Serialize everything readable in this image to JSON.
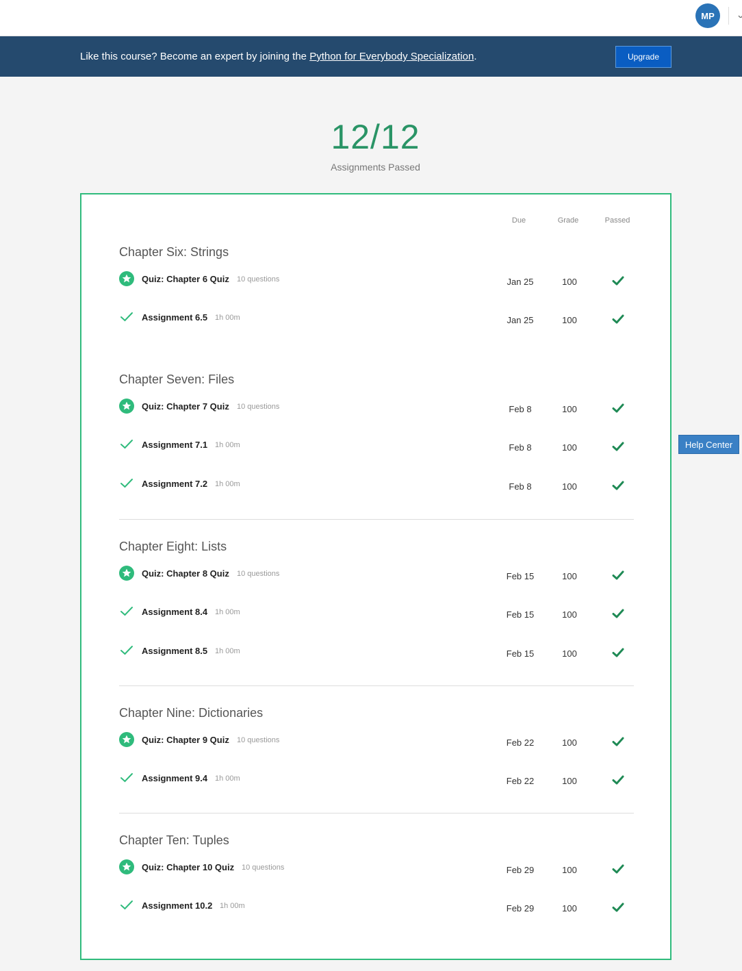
{
  "header": {
    "avatar_initials": "MP"
  },
  "banner": {
    "text_before": "Like this course? Become an expert by joining the ",
    "link_text": "Python for Everybody Specialization",
    "text_after": ".",
    "upgrade_label": "Upgrade"
  },
  "summary": {
    "score": "12/12",
    "label": "Assignments Passed"
  },
  "columns": {
    "due": "Due",
    "grade": "Grade",
    "passed": "Passed"
  },
  "sections": [
    {
      "title": "Chapter Six: Strings",
      "items": [
        {
          "type": "quiz",
          "name": "Quiz: Chapter 6 Quiz",
          "meta": "10 questions",
          "due": "Jan 25",
          "grade": "100",
          "passed": true
        },
        {
          "type": "assignment",
          "name": "Assignment 6.5",
          "meta": "1h 00m",
          "due": "Jan 25",
          "grade": "100",
          "passed": true
        }
      ]
    },
    {
      "title": "Chapter Seven: Files",
      "items": [
        {
          "type": "quiz",
          "name": "Quiz: Chapter 7 Quiz",
          "meta": "10 questions",
          "due": "Feb 8",
          "grade": "100",
          "passed": true
        },
        {
          "type": "assignment",
          "name": "Assignment 7.1",
          "meta": "1h 00m",
          "due": "Feb 8",
          "grade": "100",
          "passed": true
        },
        {
          "type": "assignment",
          "name": "Assignment 7.2",
          "meta": "1h 00m",
          "due": "Feb 8",
          "grade": "100",
          "passed": true
        }
      ]
    },
    {
      "title": "Chapter Eight: Lists",
      "items": [
        {
          "type": "quiz",
          "name": "Quiz: Chapter 8 Quiz",
          "meta": "10 questions",
          "due": "Feb 15",
          "grade": "100",
          "passed": true
        },
        {
          "type": "assignment",
          "name": "Assignment 8.4",
          "meta": "1h 00m",
          "due": "Feb 15",
          "grade": "100",
          "passed": true
        },
        {
          "type": "assignment",
          "name": "Assignment 8.5",
          "meta": "1h 00m",
          "due": "Feb 15",
          "grade": "100",
          "passed": true
        }
      ]
    },
    {
      "title": "Chapter Nine: Dictionaries",
      "items": [
        {
          "type": "quiz",
          "name": "Quiz: Chapter 9 Quiz",
          "meta": "10 questions",
          "due": "Feb 22",
          "grade": "100",
          "passed": true
        },
        {
          "type": "assignment",
          "name": "Assignment 9.4",
          "meta": "1h 00m",
          "due": "Feb 22",
          "grade": "100",
          "passed": true
        }
      ]
    },
    {
      "title": "Chapter Ten: Tuples",
      "items": [
        {
          "type": "quiz",
          "name": "Quiz: Chapter 10 Quiz",
          "meta": "10 questions",
          "due": "Feb 29",
          "grade": "100",
          "passed": true
        },
        {
          "type": "assignment",
          "name": "Assignment 10.2",
          "meta": "1h 00m",
          "due": "Feb 29",
          "grade": "100",
          "passed": true
        }
      ]
    }
  ],
  "help_center": {
    "label": "Help Center"
  },
  "colors": {
    "banner_bg": "#254a6e",
    "accent_green": "#2a9466",
    "check_green": "#1f8a55",
    "card_border": "#2fbb7c",
    "upgrade_bg": "#0a5dc2",
    "help_bg": "#3a80c5"
  },
  "icons": {
    "quiz": "star-badge-icon",
    "assignment": "checkmark-icon",
    "passed": "bold-checkmark-icon"
  }
}
